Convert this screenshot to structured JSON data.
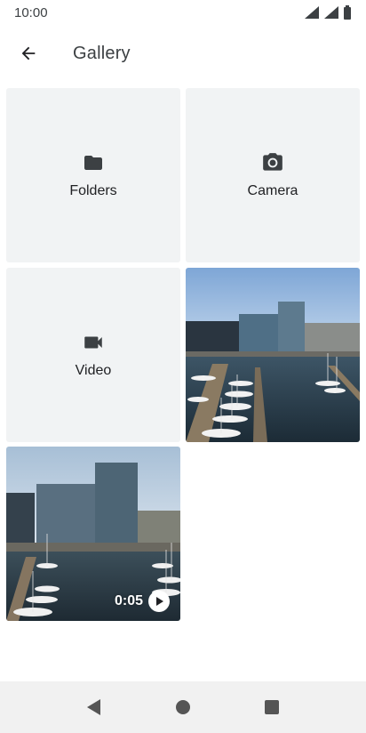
{
  "status_bar": {
    "time": "10:00"
  },
  "app_bar": {
    "title": "Gallery"
  },
  "tiles": {
    "folders_label": "Folders",
    "camera_label": "Camera",
    "video_label": "Video"
  },
  "video_item": {
    "duration": "0:05"
  },
  "icons": {
    "back": "arrow-back-icon",
    "folders": "folder-icon",
    "camera": "camera-icon",
    "video": "videocam-icon",
    "play": "play-icon",
    "nav_back": "triangle-back-icon",
    "nav_home": "circle-home-icon",
    "nav_recents": "square-recents-icon"
  },
  "colors": {
    "tile_bg": "#f1f3f4",
    "icon": "#3c4043",
    "nav_bar_bg": "#f1f1f1"
  }
}
